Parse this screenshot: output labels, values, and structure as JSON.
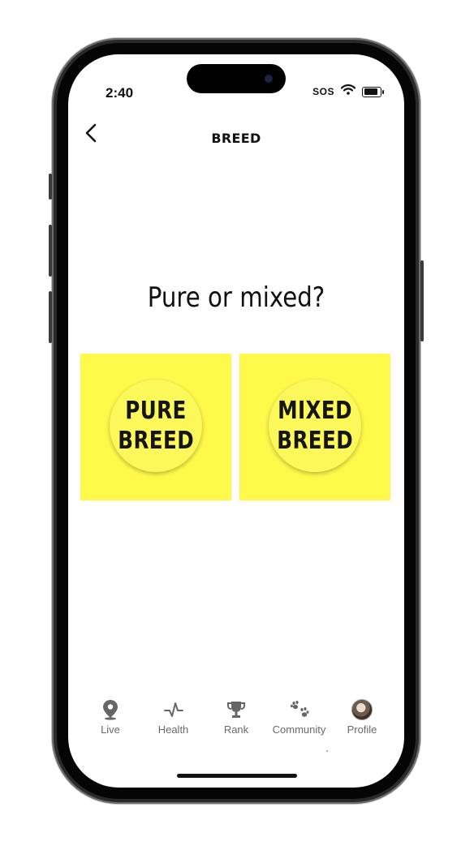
{
  "status": {
    "time": "2:40",
    "sos": "SOS"
  },
  "header": {
    "title": "BREED"
  },
  "main": {
    "question": "Pure or mixed?",
    "options": [
      {
        "line1": "PURE",
        "line2": "BREED"
      },
      {
        "line1": "MIXED",
        "line2": "BREED"
      }
    ]
  },
  "tabs": [
    {
      "label": "Live",
      "icon": "location-pin-icon"
    },
    {
      "label": "Health",
      "icon": "pulse-icon"
    },
    {
      "label": "Rank",
      "icon": "trophy-icon"
    },
    {
      "label": "Community",
      "icon": "paw-prints-icon"
    },
    {
      "label": "Profile",
      "icon": "avatar"
    }
  ],
  "colors": {
    "option_bg": "#fffa4a",
    "tab_label": "#6a6a6a"
  }
}
